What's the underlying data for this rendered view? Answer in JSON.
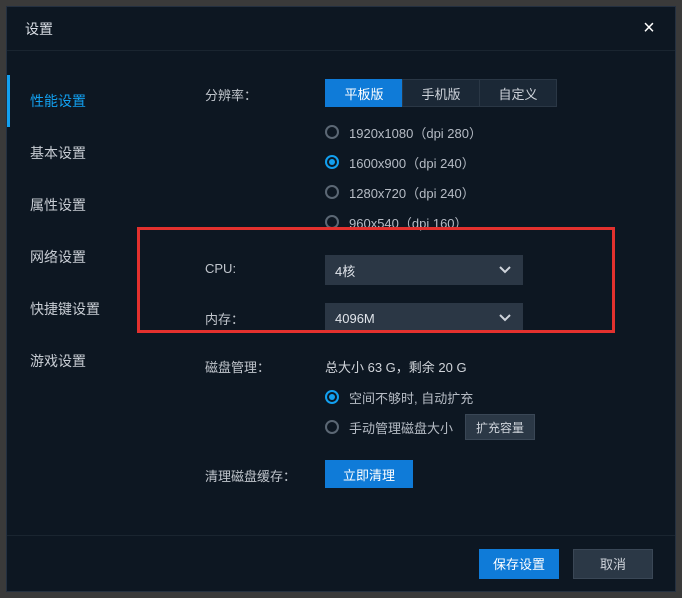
{
  "title": "设置",
  "sidebar": {
    "items": [
      {
        "label": "性能设置",
        "active": true
      },
      {
        "label": "基本设置",
        "active": false
      },
      {
        "label": "属性设置",
        "active": false
      },
      {
        "label": "网络设置",
        "active": false
      },
      {
        "label": "快捷键设置",
        "active": false
      },
      {
        "label": "游戏设置",
        "active": false
      }
    ]
  },
  "resolution": {
    "label": "分辨率：",
    "segments": [
      {
        "label": "平板版",
        "active": true
      },
      {
        "label": "手机版",
        "active": false
      },
      {
        "label": "自定义",
        "active": false
      }
    ],
    "options": [
      {
        "label": "1920x1080（dpi 280）",
        "checked": false
      },
      {
        "label": "1600x900（dpi 240）",
        "checked": true
      },
      {
        "label": "1280x720（dpi 240）",
        "checked": false
      },
      {
        "label": "960x540（dpi 160）",
        "checked": false
      }
    ]
  },
  "cpu": {
    "label": "CPU:",
    "value": "4核"
  },
  "memory": {
    "label": "内存：",
    "value": "4096M"
  },
  "disk": {
    "label": "磁盘管理：",
    "summary": "总大小 63 G，剩余 20 G",
    "auto": {
      "label": "空间不够时, 自动扩充",
      "checked": true
    },
    "manual": {
      "label": "手动管理磁盘大小",
      "checked": false
    },
    "expand_btn": "扩充容量"
  },
  "cache": {
    "label": "清理磁盘缓存：",
    "button": "立即清理"
  },
  "footer": {
    "save": "保存设置",
    "cancel": "取消"
  }
}
